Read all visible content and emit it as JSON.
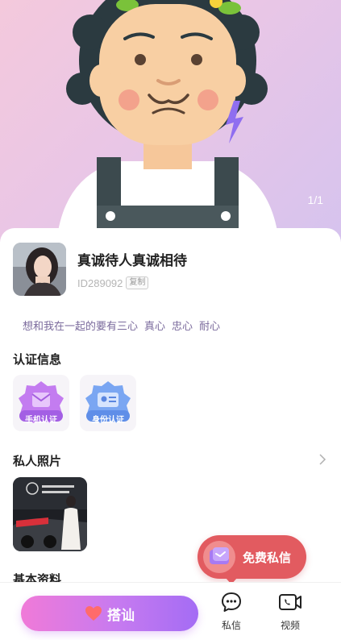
{
  "hero": {
    "photo_counter": "1/1"
  },
  "profile": {
    "nickname": "真诚待人真诚相待",
    "id_text": "ID289092",
    "copy_label": "复制",
    "bio": [
      "想和我在一起的要有三心",
      "真心",
      "忠心",
      "耐心"
    ]
  },
  "sections": {
    "verification": "认证信息",
    "photos": "私人照片",
    "basic": "基本资料"
  },
  "badges": [
    {
      "label": "手机认证",
      "color": "#b36ce8"
    },
    {
      "label": "身份认证",
      "color": "#6a9af0"
    }
  ],
  "free_message": {
    "label": "免费私信"
  },
  "bottom_bar": {
    "chat_up_label": "搭讪",
    "message_label": "私信",
    "video_label": "视频"
  },
  "colors": {
    "accent": "#e25b60",
    "brand_gradient": [
      "#f07ad8",
      "#a46cf4"
    ]
  }
}
